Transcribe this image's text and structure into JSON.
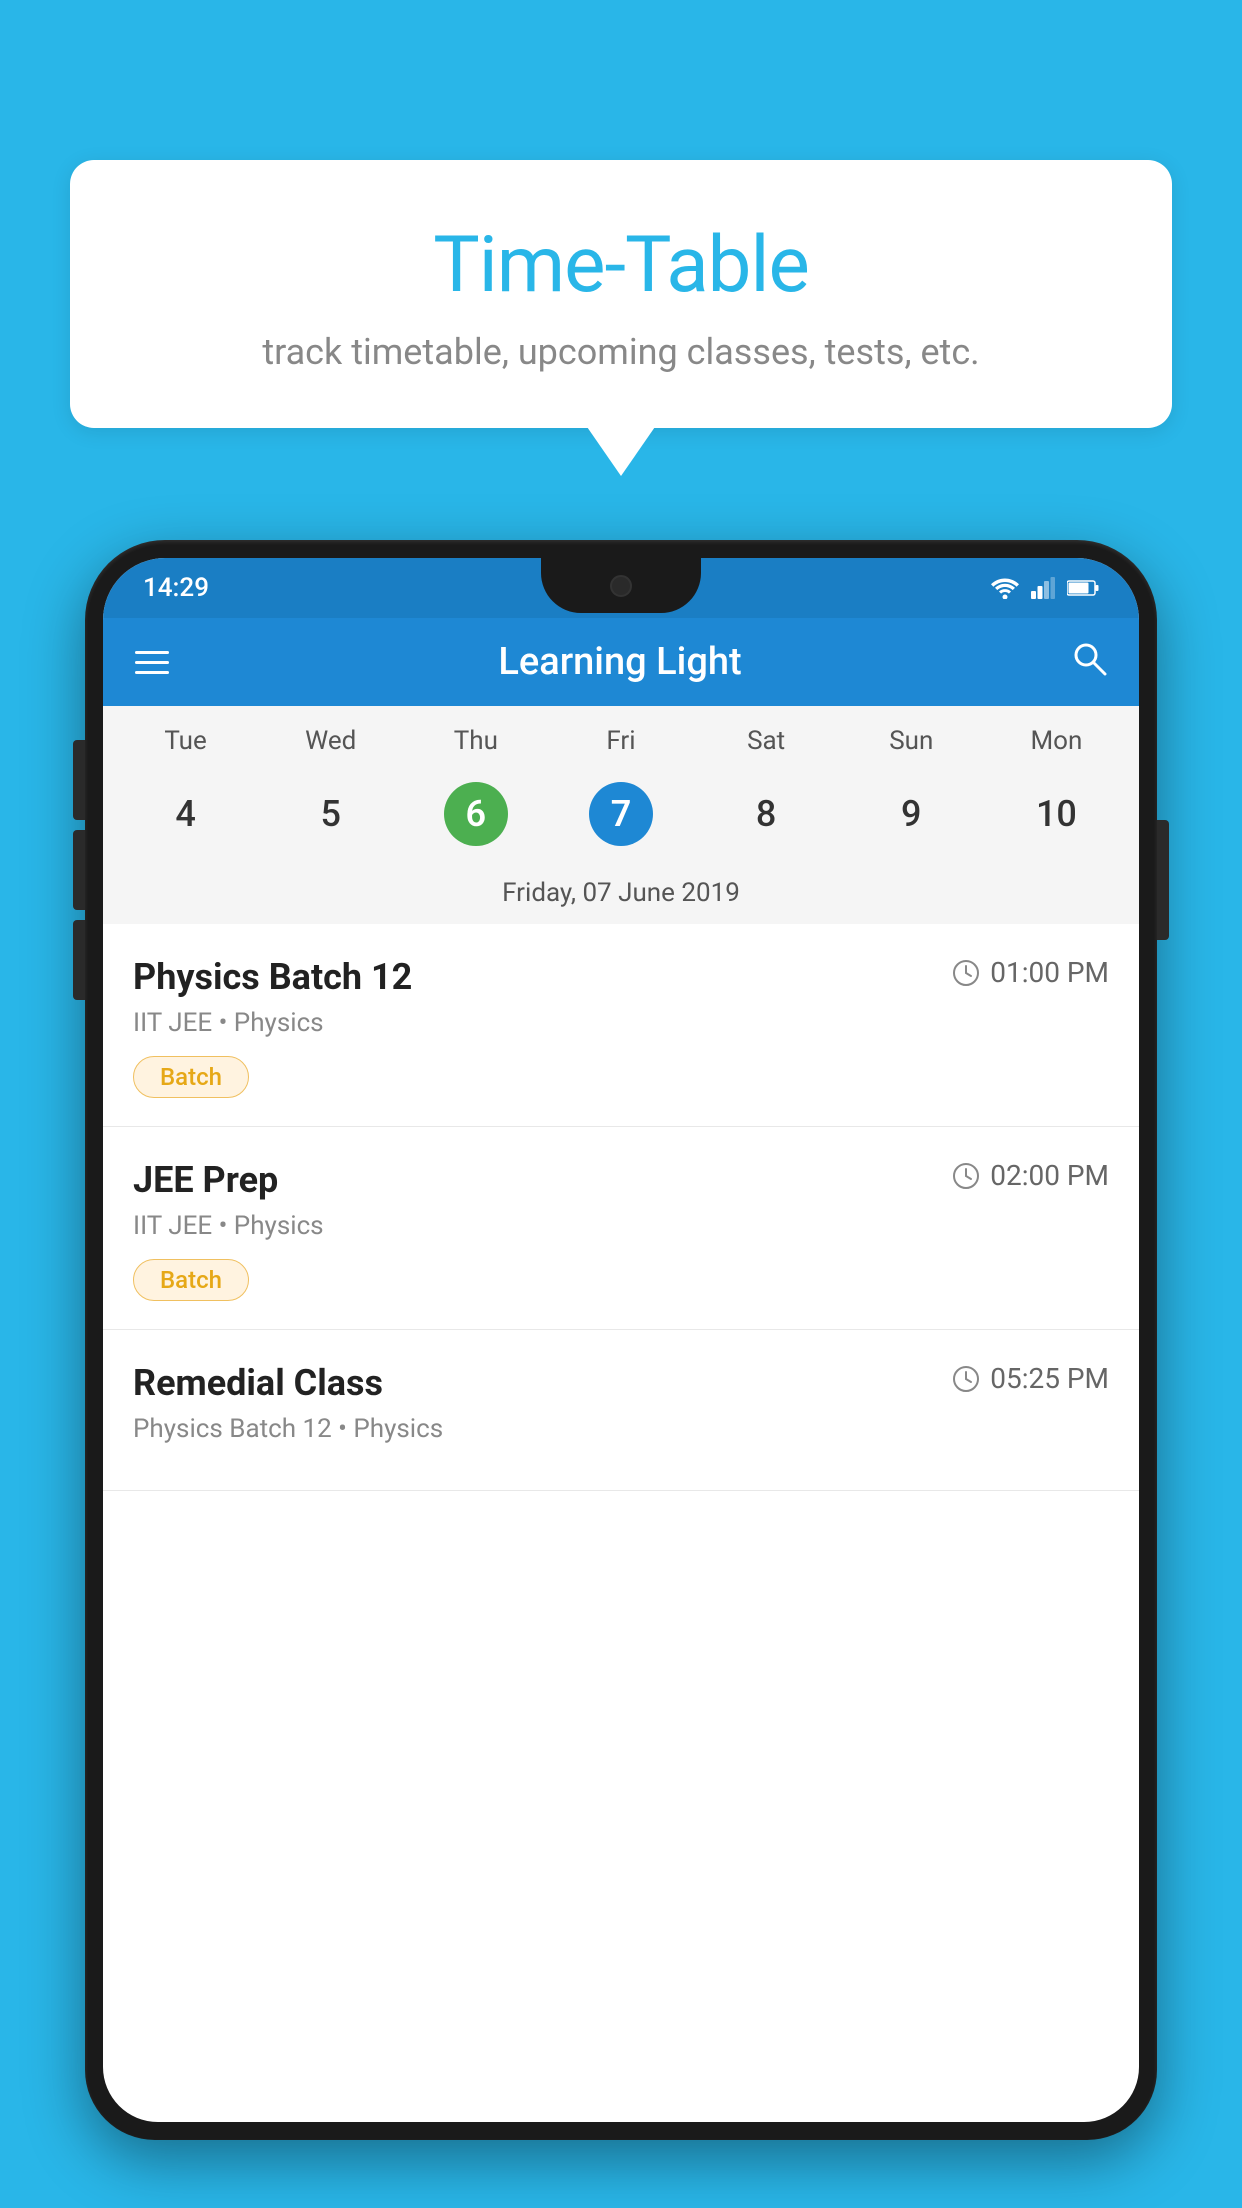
{
  "background_color": "#29b6e8",
  "speech_bubble": {
    "title": "Time-Table",
    "subtitle": "track timetable, upcoming classes, tests, etc."
  },
  "phone": {
    "status_bar": {
      "time": "14:29",
      "wifi": "▼",
      "signal": "▲",
      "battery": "▮"
    },
    "app_bar": {
      "title": "Learning Light",
      "menu_icon": "hamburger",
      "search_icon": "search"
    },
    "calendar": {
      "day_headers": [
        "Tue",
        "Wed",
        "Thu",
        "Fri",
        "Sat",
        "Sun",
        "Mon"
      ],
      "dates": [
        {
          "num": "4",
          "style": "normal"
        },
        {
          "num": "5",
          "style": "normal"
        },
        {
          "num": "6",
          "style": "green"
        },
        {
          "num": "7",
          "style": "blue"
        },
        {
          "num": "8",
          "style": "normal"
        },
        {
          "num": "9",
          "style": "normal"
        },
        {
          "num": "10",
          "style": "normal"
        }
      ],
      "selected_date_label": "Friday, 07 June 2019"
    },
    "schedule_items": [
      {
        "title": "Physics Batch 12",
        "time": "01:00 PM",
        "subtitle": "IIT JEE • Physics",
        "badge": "Batch"
      },
      {
        "title": "JEE Prep",
        "time": "02:00 PM",
        "subtitle": "IIT JEE • Physics",
        "badge": "Batch"
      },
      {
        "title": "Remedial Class",
        "time": "05:25 PM",
        "subtitle": "Physics Batch 12 • Physics",
        "badge": ""
      }
    ]
  }
}
